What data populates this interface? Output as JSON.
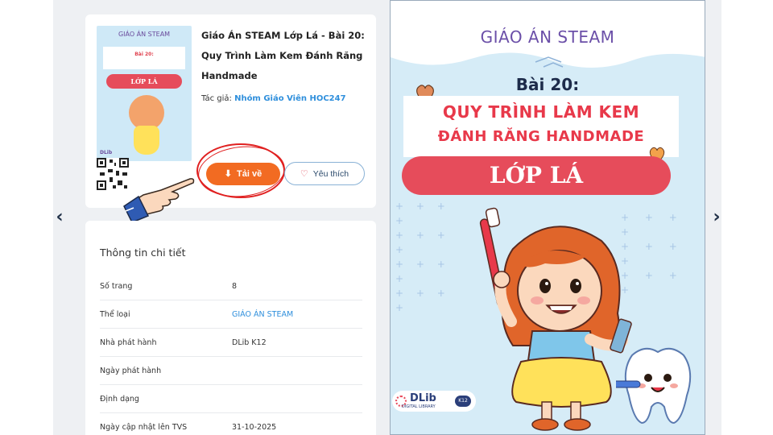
{
  "nav": {
    "prev": "‹",
    "next": "›"
  },
  "document": {
    "title": "Giáo Án STEAM Lớp Lá - Bài 20: Quy Trình Làm Kem Đánh Răng Handmade",
    "author_label": "Tác giả:",
    "author_name": "Nhóm Giáo Viên HOC247",
    "thumbnail": {
      "head": "GIÁO ÁN STEAM",
      "line1": "Bài 20:",
      "line2": "QUY TRÌNH LÀM KEM",
      "line3": "ĐÁNH RĂNG HANDMADE",
      "pill": "LỚP LÁ",
      "logo": "DLib"
    }
  },
  "actions": {
    "download_label": "Tải về",
    "like_label": "Yêu thích"
  },
  "details": {
    "title": "Thông tin chi tiết",
    "rows": [
      {
        "key": "Số trang",
        "value": "8"
      },
      {
        "key": "Thể loại",
        "value": "GIÁO ÁN STEAM"
      },
      {
        "key": "Nhà phát hành",
        "value": "DLib K12"
      },
      {
        "key": "Ngày phát hành",
        "value": ""
      },
      {
        "key": "Định dạng",
        "value": ""
      },
      {
        "key": "Ngày cập nhật lên TVS",
        "value": "31-10-2025"
      }
    ]
  },
  "cover": {
    "header": "GIÁO ÁN STEAM",
    "lesson": "Bài 20:",
    "title_line1": "QUY TRÌNH LÀM KEM",
    "title_line2": "ĐÁNH RĂNG HANDMADE",
    "grade": "LỚP LÁ",
    "logo_main": "DLib",
    "logo_sub": "DIGITAL LIBRARY",
    "logo_badge": "K12"
  },
  "colors": {
    "download": "#f26b22",
    "accent_red": "#e64c5b",
    "link_blue": "#2f8fdc",
    "purple": "#6b4fa8"
  }
}
